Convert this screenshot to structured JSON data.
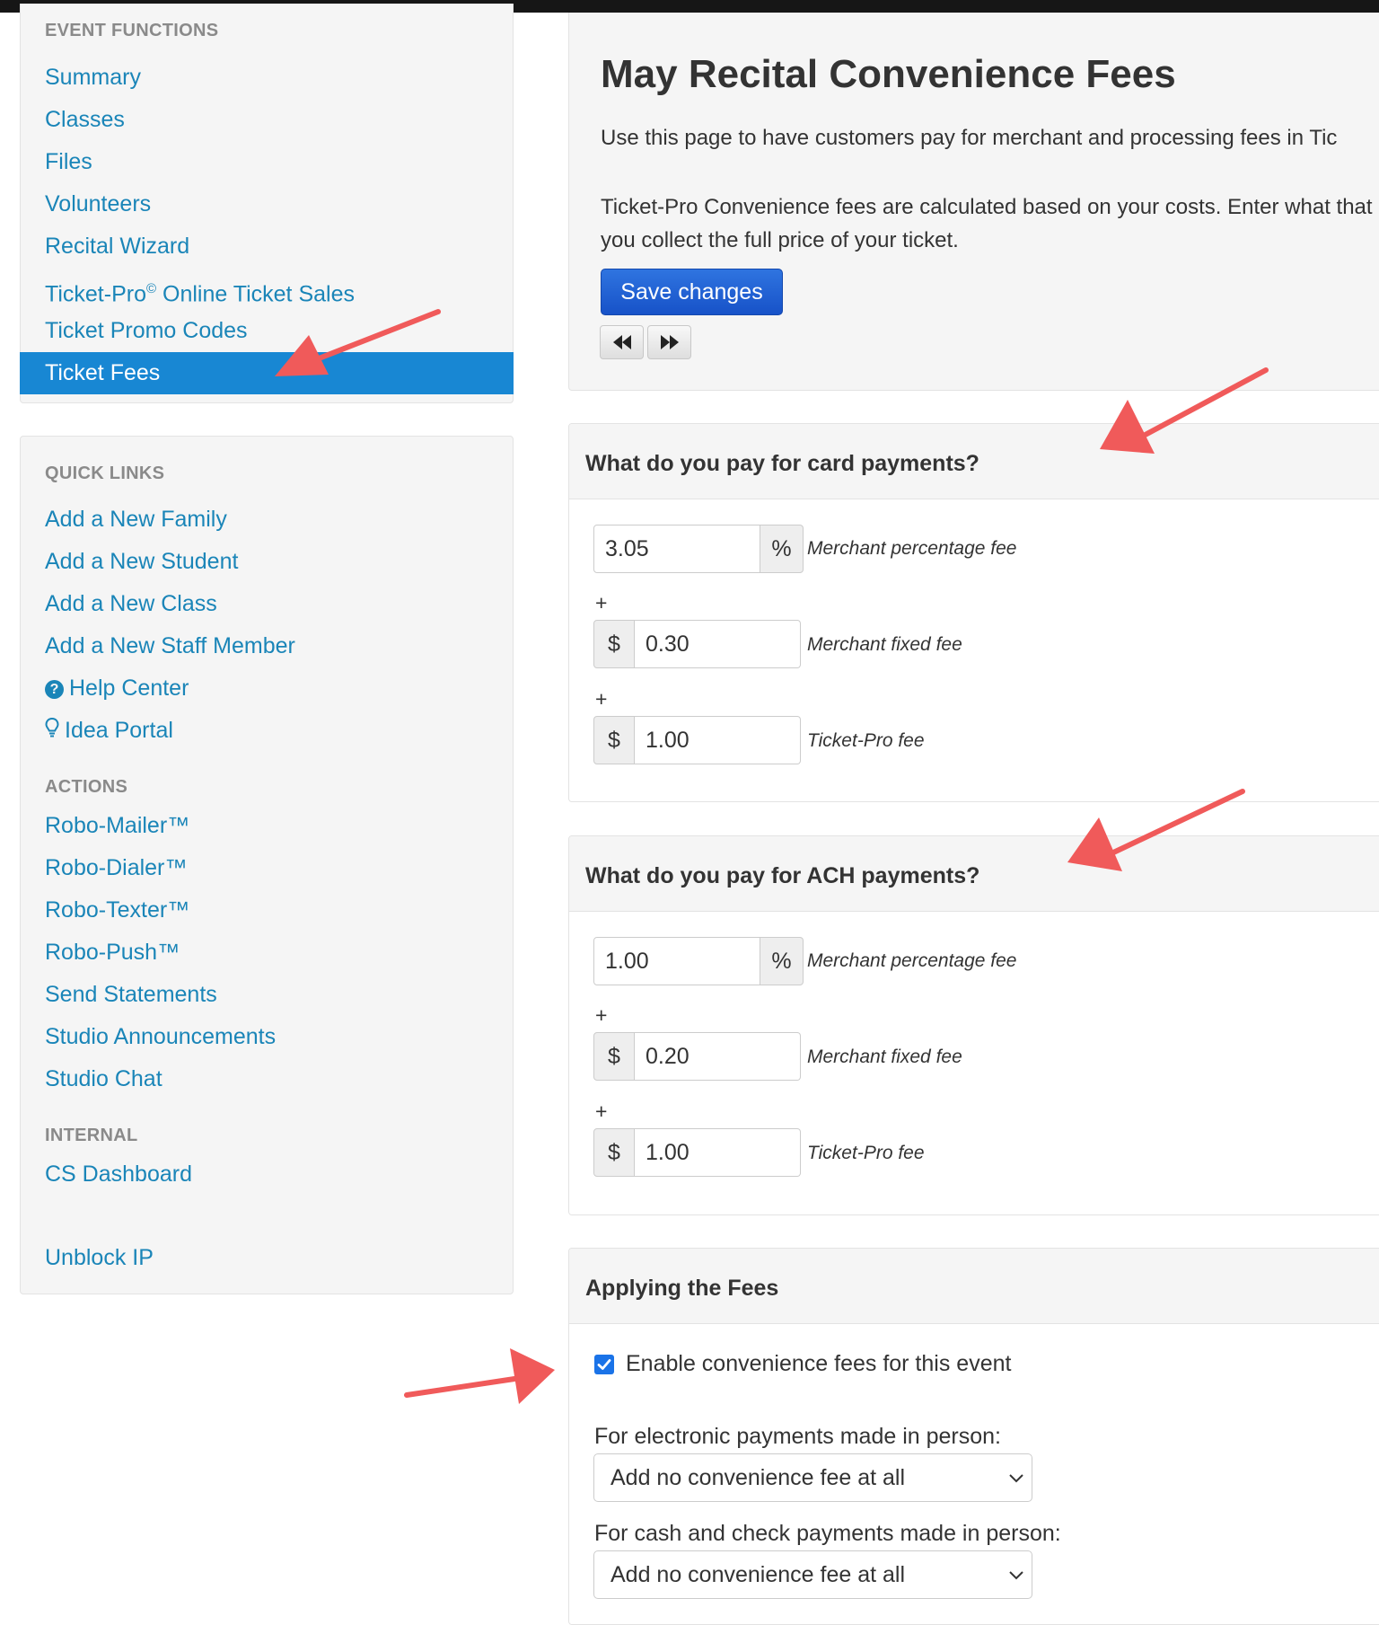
{
  "sidebar": {
    "event_functions_heading": "EVENT FUNCTIONS",
    "event_items": [
      {
        "label": "Summary"
      },
      {
        "label": "Classes"
      },
      {
        "label": "Files"
      },
      {
        "label": "Volunteers"
      },
      {
        "label": "Recital Wizard"
      },
      {
        "label": "Ticket-Pro",
        "sup": "©",
        "suffix": " Online Ticket Sales"
      },
      {
        "label": "Ticket Promo Codes"
      },
      {
        "label": "Ticket Fees"
      }
    ],
    "quick_links_heading": "QUICK LINKS",
    "quick_links": [
      {
        "label": "Add a New Family"
      },
      {
        "label": "Add a New Student"
      },
      {
        "label": "Add a New Class"
      },
      {
        "label": "Add a New Staff Member"
      },
      {
        "label": "Help Center",
        "icon": "help-circle-icon"
      },
      {
        "label": "Idea Portal",
        "icon": "lightbulb-icon"
      }
    ],
    "actions_heading": "ACTIONS",
    "actions": [
      {
        "label": "Robo-Mailer™"
      },
      {
        "label": "Robo-Dialer™"
      },
      {
        "label": "Robo-Texter™"
      },
      {
        "label": "Robo-Push™"
      },
      {
        "label": "Send Statements"
      },
      {
        "label": "Studio Announcements"
      },
      {
        "label": "Studio Chat"
      }
    ],
    "internal_heading": "INTERNAL",
    "internal": [
      {
        "label": "CS Dashboard"
      },
      {
        "label": "Unblock IP"
      }
    ]
  },
  "main": {
    "title": "May Recital Convenience Fees",
    "intro_1": "Use this page to have customers pay for merchant and processing fees in Tic",
    "intro_2": "Ticket-Pro Convenience fees are calculated based on your costs. Enter what that you collect the full price of your ticket.",
    "save_label": "Save changes",
    "card_section": {
      "heading": "What do you pay for card payments?",
      "pct_value": "3.05",
      "pct_label": "Merchant percentage fee",
      "fixed_value": "0.30",
      "fixed_label": "Merchant fixed fee",
      "tp_value": "1.00",
      "tp_label": "Ticket-Pro fee"
    },
    "ach_section": {
      "heading": "What do you pay for ACH payments?",
      "pct_value": "1.00",
      "pct_label": "Merchant percentage fee",
      "fixed_value": "0.20",
      "fixed_label": "Merchant fixed fee",
      "tp_value": "1.00",
      "tp_label": "Ticket-Pro fee"
    },
    "applying": {
      "heading": "Applying the Fees",
      "enable_label": "Enable convenience fees for this event",
      "enable_checked": true,
      "electronic_label": "For electronic payments made in person:",
      "electronic_value": "Add no convenience fee at all",
      "cash_label": "For cash and check payments made in person:",
      "cash_value": "Add no convenience fee at all"
    }
  },
  "symbols": {
    "percent": "%",
    "dollar": "$",
    "plus": "+"
  },
  "colors": {
    "link": "#1a85b8",
    "active_bg": "#1887d3",
    "save_button": "#1f5fd6",
    "annotation_arrow": "#f05a5a",
    "checkbox": "#1a73e8"
  }
}
